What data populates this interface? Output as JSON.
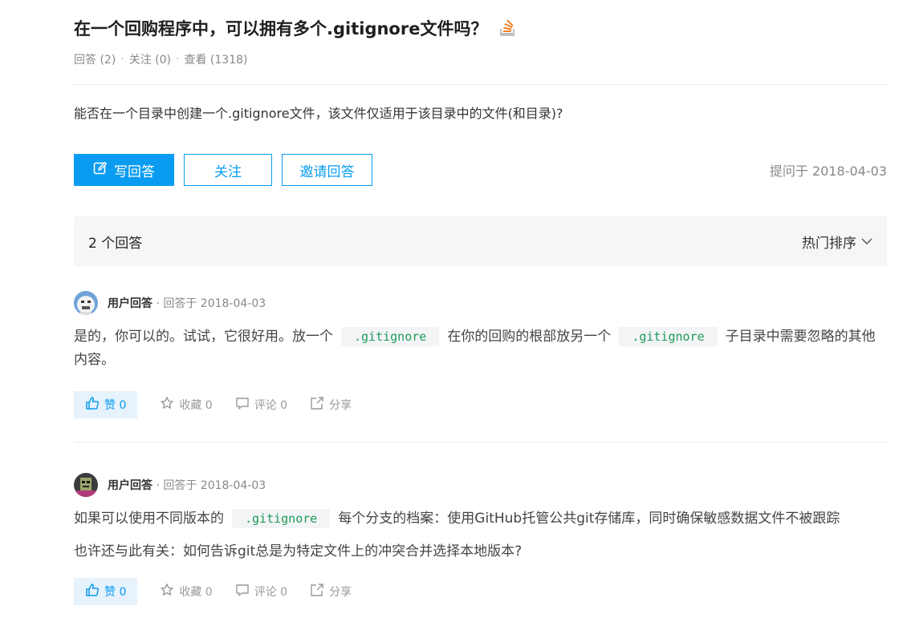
{
  "question": {
    "title": "在一个回购程序中，可以拥有多个.gitignore文件吗？",
    "meta": {
      "answers_label": "回答 (2)",
      "follows_label": "关注 (0)",
      "views_label": "查看 (1318)"
    },
    "body": "能否在一个目录中创建一个.gitignore文件，该文件仅适用于该目录中的文件(和目录)?",
    "buttons": {
      "write_answer": "写回答",
      "follow": "关注",
      "invite": "邀请回答"
    },
    "asked_at": "提问于 2018-04-03"
  },
  "answers_bar": {
    "count_label": "2 个回答",
    "sort_label": "热门排序"
  },
  "answers": [
    {
      "author": "用户回答",
      "meta": " · 回答于 2018-04-03",
      "text": {
        "part1": "是的，你可以的。试试，它很好用。放一个",
        "code1": ".gitignore",
        "part2": "在你的回购的根部放另一个",
        "code2": ".gitignore",
        "part3": "子目录中需要忽略的其他内容。"
      },
      "actions": {
        "like": "赞 0",
        "favorite": "收藏 0",
        "comment": "评论 0",
        "share": "分享"
      }
    },
    {
      "author": "用户回答",
      "meta": " · 回答于 2018-04-03",
      "text": {
        "part1": "如果可以使用不同版本的",
        "code1": ".gitignore",
        "part2": "每个分支的档案：使用GitHub托管公共git存储库，同时确保敏感数据文件不被跟踪",
        "line2": "也许还与此有关：如何告诉git总是为特定文件上的冲突合并选择本地版本?"
      },
      "actions": {
        "like": "赞 0",
        "favorite": "收藏 0",
        "comment": "评论 0",
        "share": "分享"
      }
    }
  ],
  "colors": {
    "primary": "#0a9cf0",
    "code_text": "#1e9a5c",
    "code_bg": "#f3f4f5",
    "like_bg": "#e6f2fc",
    "answers_bar_bg": "#f5f6f8",
    "stackoverflow_orange": "#f48024"
  }
}
